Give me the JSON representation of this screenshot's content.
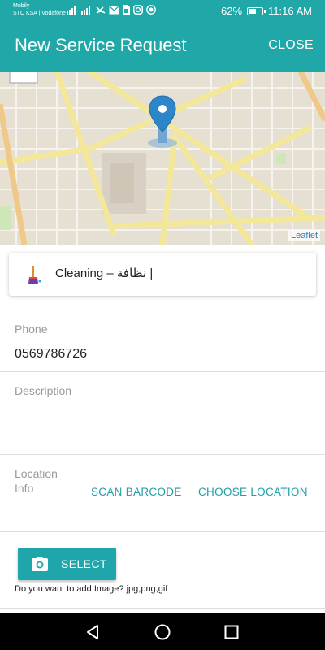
{
  "status_bar": {
    "carrier_line1": "Mobily",
    "carrier_line2": "STC KSA | Vodafone",
    "icons": [
      "signal-icon",
      "signal-icon",
      "missed-call-icon",
      "mail-icon",
      "sim-icon",
      "instagram-icon",
      "whatsapp-icon"
    ],
    "battery_percent": "62%",
    "battery_level": 0.62,
    "time": "11:16 AM"
  },
  "app_bar": {
    "title": "New Service Request",
    "close_label": "CLOSE",
    "color": "#20a8a8"
  },
  "map": {
    "attribution": "Leaflet",
    "pin_icon": "map-pin-icon"
  },
  "category": {
    "icon": "cleaning-broom-icon",
    "label": "Cleaning – نظافة |"
  },
  "form": {
    "phone_label": "Phone",
    "phone_value": "0569786726",
    "description_label": "Description",
    "description_value": "",
    "location_label_line1": "Location",
    "location_label_line2": "Info",
    "scan_barcode_label": "SCAN BARCODE",
    "choose_location_label": "CHOOSE LOCATION",
    "select_label": "SELECT",
    "select_icon": "camera-icon",
    "image_hint": "Do you want to add Image? jpg,png,gif"
  },
  "nav": {
    "back_icon": "back-triangle-icon",
    "home_icon": "home-circle-icon",
    "recents_icon": "recents-square-icon"
  }
}
